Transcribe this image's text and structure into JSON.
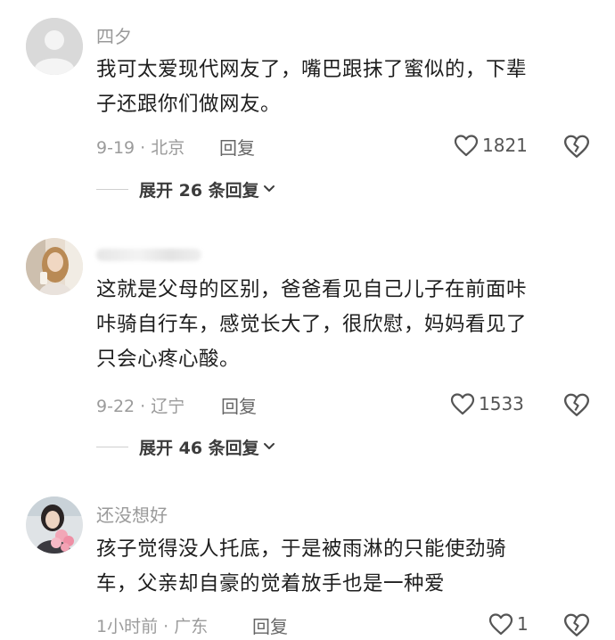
{
  "comments": [
    {
      "username": "四夕",
      "avatar": "default-avatar",
      "text_lines": [
        "我可太爱现代网友了，嘴巴跟抹了蜜似的，下辈",
        "子还跟你们做网友。"
      ],
      "date_location": "9-19 · 北京",
      "reply_label": "回复",
      "likes": "1821",
      "expand_label": "展开 26 条回复"
    },
    {
      "username": "",
      "avatar": "photo-avatar-woman",
      "text_lines": [
        "这就是父母的区别，爸爸看见自己儿子在前面咔",
        "咔骑自行车，感觉长大了，很欣慰，妈妈看见了",
        "只会心疼心酸。"
      ],
      "date_location": "9-22 · 辽宁",
      "reply_label": "回复",
      "likes": "1533",
      "expand_label": "展开 46 条回复"
    },
    {
      "username": "还没想好",
      "avatar": "photo-avatar-flowers",
      "text_lines": [
        "孩子觉得没人托底，于是被雨淋的只能使劲骑",
        "车，父亲却自豪的觉着放手也是一种爱"
      ],
      "date_location": "1小时前 · 广东",
      "reply_label": "回复",
      "likes": "1",
      "expand_label": ""
    }
  ],
  "icons": {
    "like": "heart-outline-icon",
    "dislike": "broken-heart-icon",
    "expand": "chevron-down-icon"
  },
  "colors": {
    "meta_gray": "#9b9b9b",
    "text": "#1e1e1e",
    "icon_gray": "#555555"
  }
}
